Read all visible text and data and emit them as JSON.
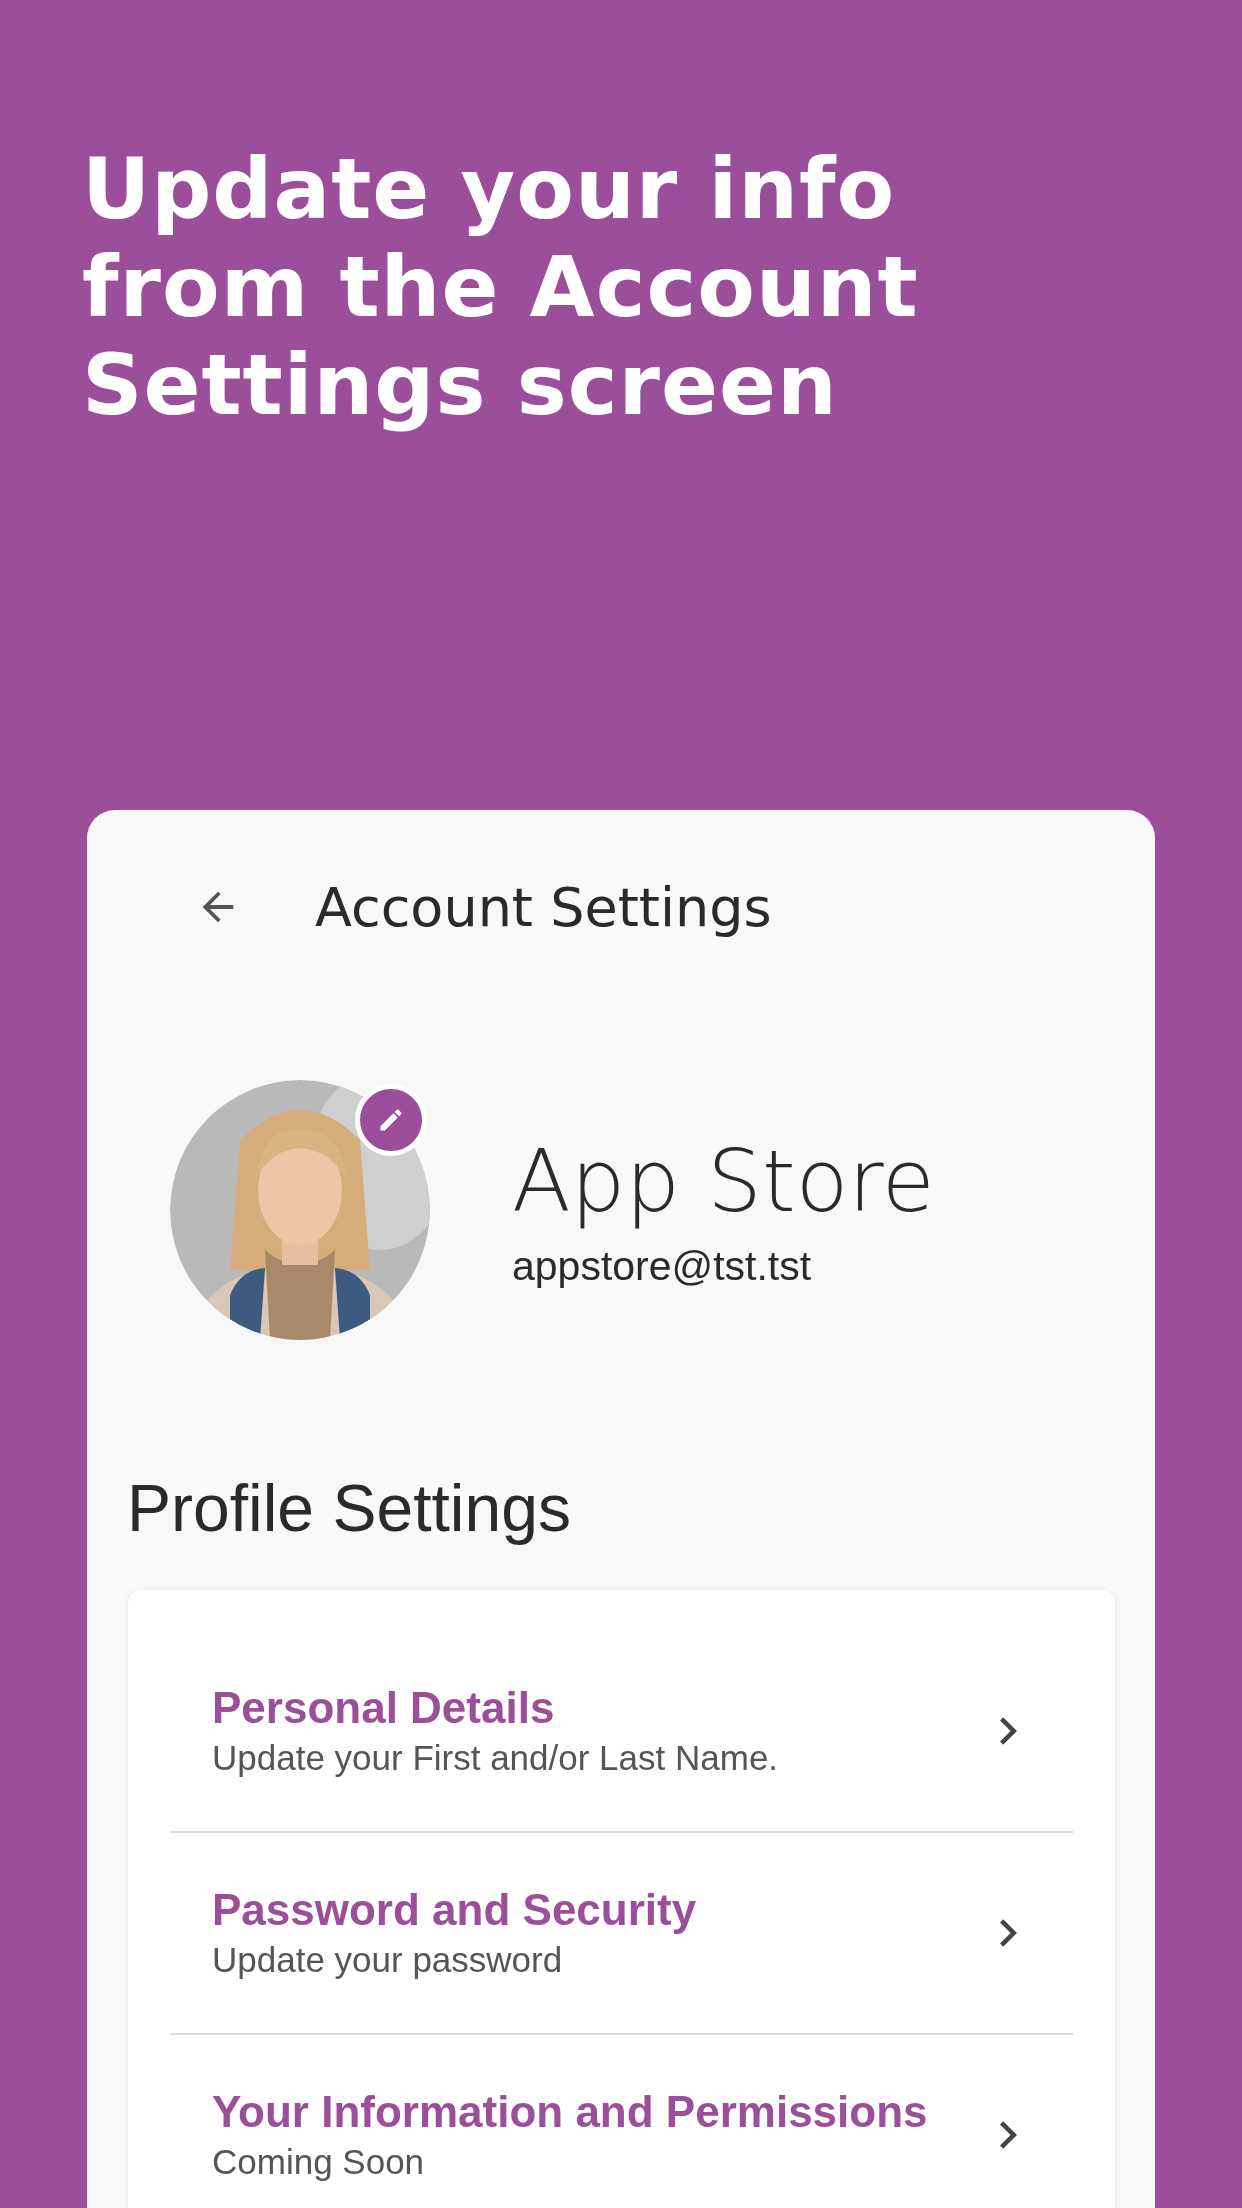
{
  "headline": "Update your info from the Account Settings screen",
  "screen": {
    "title": "Account Settings",
    "profile": {
      "name": "App Store",
      "email": "appstore@tst.tst"
    },
    "section_title": "Profile Settings",
    "items": [
      {
        "title": "Personal Details",
        "subtitle": "Update your First and/or Last Name."
      },
      {
        "title": "Password and Security",
        "subtitle": "Update your password"
      },
      {
        "title": "Your Information and Permissions",
        "subtitle": "Coming Soon"
      }
    ]
  }
}
